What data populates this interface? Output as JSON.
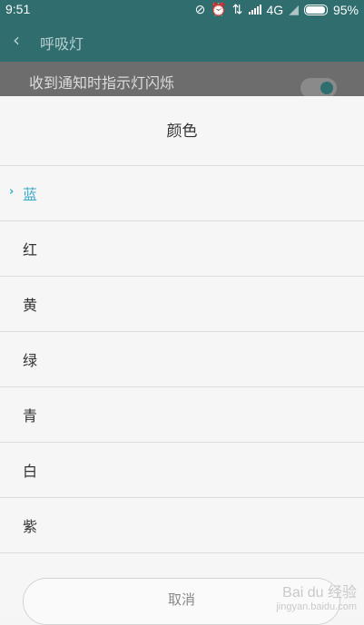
{
  "status_bar": {
    "time": "9:51",
    "network": "4G",
    "battery": "95%"
  },
  "app_bar": {
    "title": "呼吸灯"
  },
  "background_setting": {
    "label": "收到通知时指示灯闪烁"
  },
  "dialog": {
    "title": "颜色",
    "options": [
      {
        "label": "蓝",
        "selected": true
      },
      {
        "label": "红",
        "selected": false
      },
      {
        "label": "黄",
        "selected": false
      },
      {
        "label": "绿",
        "selected": false
      },
      {
        "label": "青",
        "selected": false
      },
      {
        "label": "白",
        "selected": false
      },
      {
        "label": "紫",
        "selected": false
      }
    ],
    "cancel_label": "取消",
    "check_glyph": "›"
  },
  "watermark": {
    "brand": "Bai du 经验",
    "url": "jingyan.baidu.com"
  },
  "colors": {
    "accent": "#3aaacb",
    "header": "#2f6d6e"
  }
}
